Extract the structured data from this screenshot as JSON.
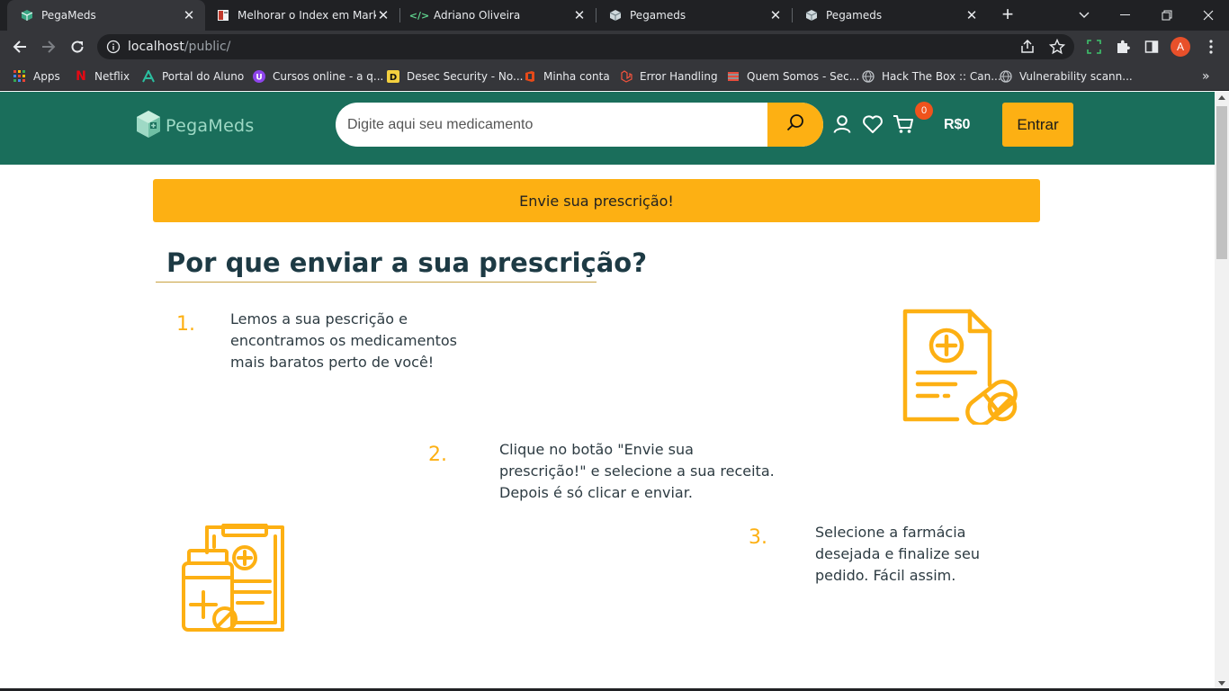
{
  "browser": {
    "tabs": [
      {
        "title": "PegaMeds",
        "active": true
      },
      {
        "title": "Melhorar o Index em Marketp",
        "active": false
      },
      {
        "title": "Adriano Oliveira",
        "active": false
      },
      {
        "title": "Pegameds",
        "active": false
      },
      {
        "title": "Pegameds",
        "active": false
      }
    ],
    "url_host": "localhost",
    "url_path": "/public/",
    "profile_initial": "A",
    "bookmarks": [
      {
        "label": "Apps",
        "icon": "apps-grid-icon"
      },
      {
        "label": "Netflix",
        "icon": "netflix-icon"
      },
      {
        "label": "Portal do Aluno",
        "icon": "portal-aluno-icon"
      },
      {
        "label": "Cursos online - a q...",
        "icon": "cursos-online-icon"
      },
      {
        "label": "Desec Security - No...",
        "icon": "desec-icon"
      },
      {
        "label": "Minha conta",
        "icon": "office-icon"
      },
      {
        "label": "Error Handling",
        "icon": "laravel-icon"
      },
      {
        "label": "Quem Somos - Sec...",
        "icon": "quem-somos-icon"
      },
      {
        "label": "Hack The Box :: Can...",
        "icon": "globe-icon"
      },
      {
        "label": "Vulnerability scann...",
        "icon": "globe-icon"
      }
    ]
  },
  "header": {
    "logo_text": "PegaMeds",
    "search_placeholder": "Digite aqui seu medicamento",
    "cart_count": "0",
    "cart_total": "R$0",
    "login_label": "Entrar"
  },
  "banner": {
    "label": "Envie sua prescrição!"
  },
  "section": {
    "title": "Por que enviar a sua prescrição?",
    "steps": [
      {
        "number": "1.",
        "text": "Lemos a sua pescrição e\nencontramos os medicamentos\nmais baratos perto de você!"
      },
      {
        "number": "2.",
        "text": "Clique no botão \"Envie sua\nprescrição!\" e selecione a sua receita.\nDepois é só clicar e enviar."
      },
      {
        "number": "3.",
        "text": "Selecione a farmácia\ndesejada e finalize seu\npedido. Fácil assim."
      }
    ]
  },
  "colors": {
    "header_green": "#1a6e5b",
    "accent_yellow": "#fdb013",
    "badge_orange": "#f0531c"
  }
}
